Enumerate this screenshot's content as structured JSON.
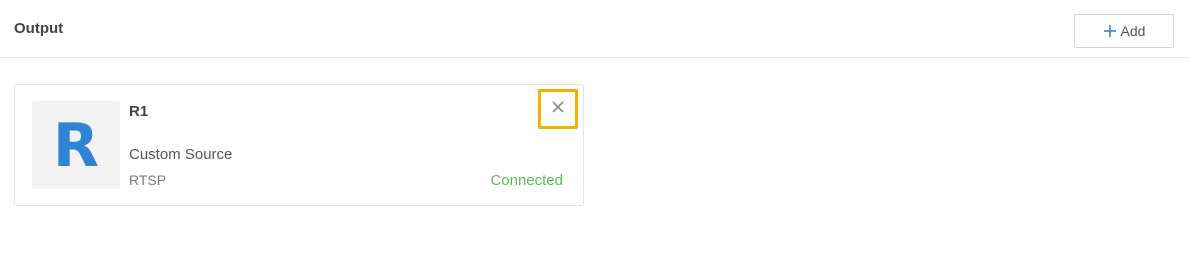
{
  "header": {
    "title": "Output",
    "add_label": "Add"
  },
  "outputs": [
    {
      "logo_letter": "R",
      "name": "R1",
      "source": "Custom Source",
      "protocol": "RTSP",
      "status": "Connected"
    }
  ],
  "colors": {
    "accent": "#2f84d3",
    "status_connected": "#5cb85c",
    "highlight": "#f0b400"
  },
  "icons": {
    "add": "plus-icon",
    "close": "close-icon"
  }
}
